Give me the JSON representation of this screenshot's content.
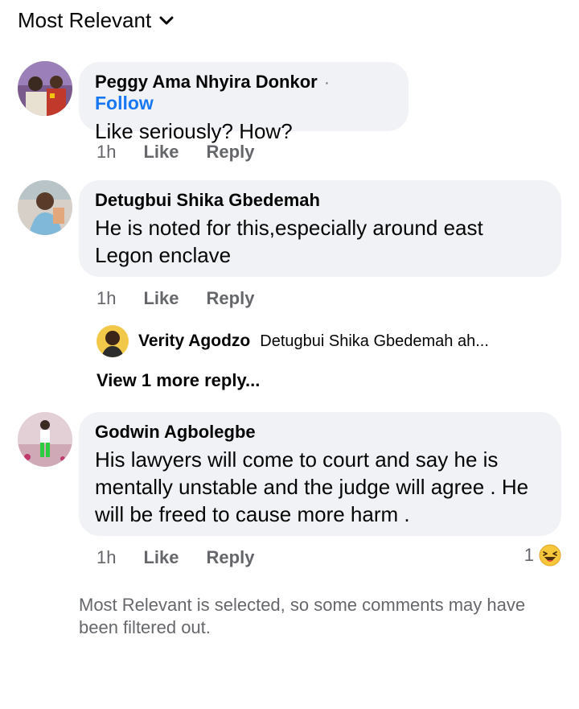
{
  "sort": {
    "label": "Most Relevant"
  },
  "comments": [
    {
      "author": "Peggy Ama Nhyira Donkor",
      "follow": "Follow",
      "separator": "·",
      "text": "Like seriously? How?",
      "time": "1h",
      "like": "Like",
      "reply": "Reply"
    },
    {
      "author": "Detugbui Shika Gbedemah",
      "text": "He is noted for this,especially around east Legon enclave",
      "time": "1h",
      "like": "Like",
      "reply": "Reply",
      "reply_preview": {
        "author": "Verity Agodzo",
        "text": "Detugbui Shika Gbedemah ah..."
      },
      "view_more": "View 1 more reply..."
    },
    {
      "author": "Godwin Agbolegbe",
      "text": "His lawyers will come to court and say he is mentally unstable and the judge will agree . He will be freed to cause more harm .",
      "time": "1h",
      "like": "Like",
      "reply": "Reply",
      "reaction_count": "1",
      "reaction_icon": "laughing-emoji-icon"
    }
  ],
  "footnote": "Most Relevant is selected, so some comments may have been filtered out.",
  "colors": {
    "bubble": "#f0f2f5",
    "link": "#1877f2",
    "muted": "#65676b",
    "text": "#050505"
  }
}
